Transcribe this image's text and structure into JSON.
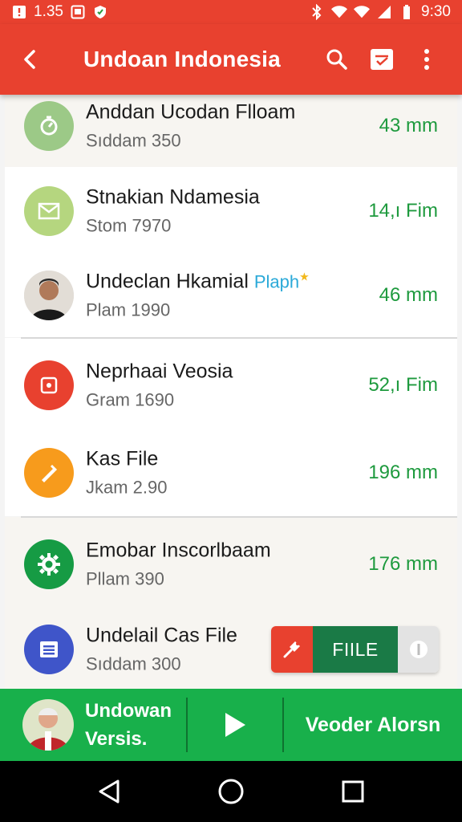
{
  "status_bar": {
    "time_left": "1.35",
    "time_right": "9:30",
    "icons": [
      "notification-icon",
      "calendar-icon",
      "shield-icon",
      "bluetooth-icon",
      "wifi-icon",
      "signal-icon",
      "battery-icon"
    ]
  },
  "app_bar": {
    "title": "Undoan Indonesia",
    "actions": [
      "back-icon",
      "search-icon",
      "check-box-icon",
      "more-vert-icon"
    ]
  },
  "list": [
    {
      "name": "Anddan Ucodan Flloam",
      "sub": "Sıddam 350",
      "value": "43 mm",
      "avatar_color": "#9cc987",
      "icon": "timer-icon"
    },
    {
      "name": "Stnakian Ndamesia",
      "sub": "Stom 7970",
      "value": "14,ı Fim",
      "avatar_color": "#b5d67f",
      "icon": "mail-icon"
    },
    {
      "name": "Undeclan Hkamial",
      "tag": "Plaph",
      "sub": "Plam 1990",
      "value": "46 mm",
      "avatar_color": "#3a3a3a",
      "icon": "person-photo"
    },
    {
      "name": "Neprhaai Veosia",
      "sub": "Gram 1690",
      "value": "52,ı Fim",
      "avatar_color": "#e8412f",
      "icon": "record-icon"
    },
    {
      "name": "Kas File",
      "sub": "Jkam 2.90",
      "value": "196 mm",
      "avatar_color": "#f79b1c",
      "icon": "edit-icon"
    },
    {
      "name": "Emobar Inscorlbaam",
      "sub": "Pllam 390",
      "value": "176 mm",
      "avatar_color": "#169b44",
      "icon": "settings-icon"
    },
    {
      "name": "Undelail Cas File",
      "sub": "Sıddam 300",
      "value": "",
      "avatar_color": "#3f55c9",
      "icon": "list-icon"
    }
  ],
  "file_pill": {
    "label": "FIILE"
  },
  "bottom_bar": {
    "left_label_line1": "Undowan",
    "left_label_line2": "Versis.",
    "right_label": "Veoder Alorsn"
  },
  "colors": {
    "accent": "#e8412f",
    "green": "#18b04b",
    "value_green": "#1e9a3e"
  }
}
